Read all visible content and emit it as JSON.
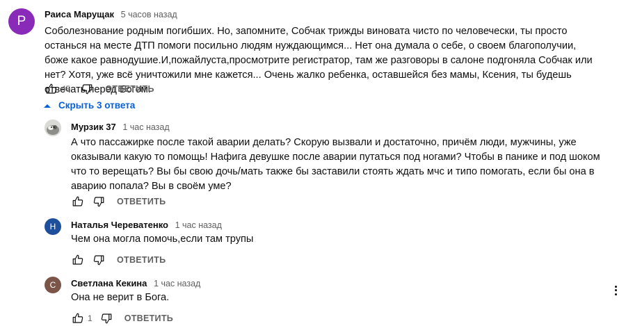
{
  "comments": [
    {
      "author": "Раиса Марущак",
      "time": "5 часов назад",
      "avatar_letter": "P",
      "avatar_color": "#8a2ab8",
      "text": "Соболезнование родным погибших. Но, запомните, Собчак трижды виновата чисто по человечески, ты просто останься на месте ДТП помоги посильно людям нуждающимся... Нет она думала о себе, о своем благополучии, боже какое равнодушие.И,пожайлуста,просмотрите регистратор, там же разговоры в салоне подгоняла Собчак или нет? Хотя, уже  всё уничтожили мне кажется... Очень жалко ребенка, оставшейся без мамы, Ксения, ты будешь отвечать перед Богом.",
      "likes": "45",
      "reply_label": "ОТВЕТИТЬ"
    }
  ],
  "hide_replies_label": "Скрыть 3 ответа",
  "replies": [
    {
      "author": "Мурзик 37",
      "time": "1 час назад",
      "avatar_icon": "cat-photo-avatar",
      "text": "А что пассажирке после такой аварии делать? Скорую вызвали и достаточно, причём люди, мужчины, уже оказывали какую то помощь! Нафига девушке после аварии путаться под ногами? Чтобы в панике и под шоком что то верещать? Вы бы свою дочь/мать также бы заставили стоять ждать мчс и типо помогать, если бы она в аварию попала? Вы в своём уме?",
      "likes": "",
      "reply_label": "ОТВЕТИТЬ"
    },
    {
      "author": "Наталья Череватенко",
      "time": "1 час назад",
      "avatar_letter": "Н",
      "avatar_color": "#1e4f9c",
      "text": "Чем она могла помочь,если там трупы",
      "likes": "",
      "reply_label": "ОТВЕТИТЬ"
    },
    {
      "author": "Светлана Кекина",
      "time": "1 час назад",
      "avatar_letter": "С",
      "avatar_color": "#7a5548",
      "text": "Она не верит в Бога.",
      "likes": "1",
      "reply_label": "ОТВЕТИТЬ"
    }
  ],
  "colors": {
    "link_blue": "#065fd4",
    "secondary_text": "#606060"
  }
}
